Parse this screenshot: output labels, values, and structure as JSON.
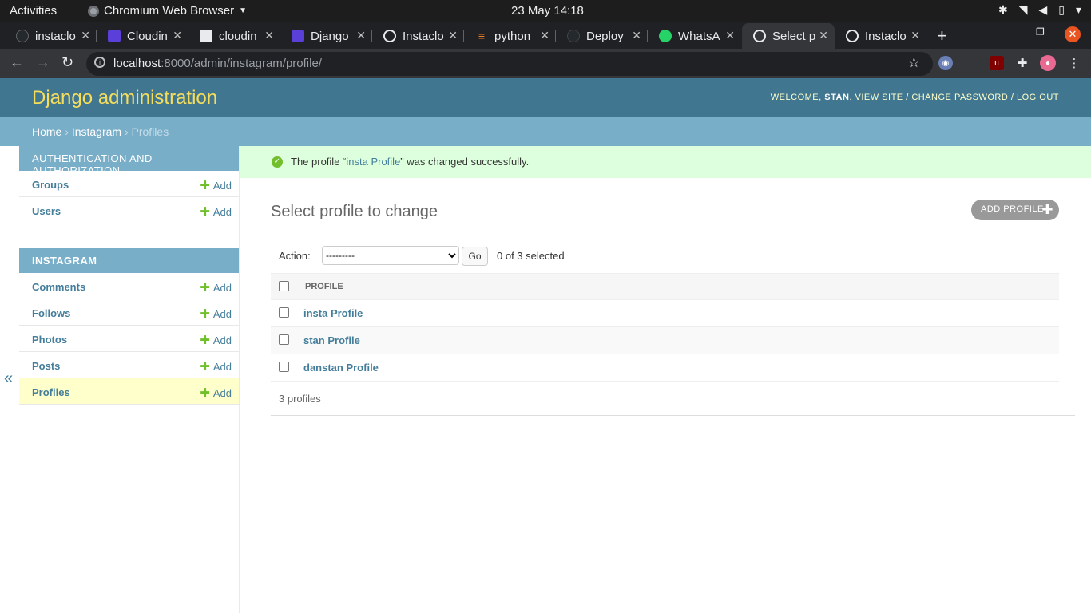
{
  "system": {
    "activities": "Activities",
    "app_name": "Chromium Web Browser",
    "clock": "23 May  14:18"
  },
  "tabs": [
    {
      "title": "instaclo",
      "icon": "github-icon",
      "color": "#24292e"
    },
    {
      "title": "Cloudin",
      "icon": "cloudinary-icon",
      "color": "#5b3fd9"
    },
    {
      "title": "cloudin",
      "icon": "package-icon",
      "color": "#e8eaed"
    },
    {
      "title": "Django",
      "icon": "cloudinary-icon",
      "color": "#5b3fd9"
    },
    {
      "title": "Instaclo",
      "icon": "globe-icon",
      "color": "#e8eaed"
    },
    {
      "title": "python",
      "icon": "stackoverflow-icon",
      "color": "#f48024"
    },
    {
      "title": "Deploy",
      "icon": "github-icon",
      "color": "#24292e"
    },
    {
      "title": "WhatsA",
      "icon": "whatsapp-icon",
      "color": "#25d366"
    },
    {
      "title": "Select p",
      "icon": "globe-icon",
      "color": "#e8eaed"
    },
    {
      "title": "Instaclo",
      "icon": "globe-icon",
      "color": "#e8eaed"
    }
  ],
  "toolbar": {
    "url_host": "localhost",
    "url_rest": ":8000/admin/instagram/profile/"
  },
  "header": {
    "branding": "Django administration",
    "welcome": "Welcome,",
    "username": "stan",
    "view_site": "View site",
    "change_password": "Change password",
    "log_out": "Log out"
  },
  "breadcrumbs": {
    "home": "Home",
    "app": "Instagram",
    "current": "Profiles"
  },
  "sidebar": {
    "toggle": "«",
    "add_label": "Add",
    "auth_caption": "AUTHENTICATION AND AUTHORIZATION",
    "auth_items": [
      {
        "name": "Groups"
      },
      {
        "name": "Users"
      }
    ],
    "insta_caption": "INSTAGRAM",
    "insta_items": [
      {
        "name": "Comments"
      },
      {
        "name": "Follows"
      },
      {
        "name": "Photos"
      },
      {
        "name": "Posts"
      },
      {
        "name": "Profiles"
      }
    ]
  },
  "message": {
    "prefix": "The profile “",
    "link": "insta Profile",
    "suffix": "” was changed successfully."
  },
  "content": {
    "title": "Select profile to change",
    "add_button": "Add profile",
    "action_label": "Action:",
    "action_selected": "---------",
    "go": "Go",
    "selected_count": "0 of 3 selected",
    "column_header": "PROFILE",
    "rows": [
      "insta Profile",
      "stan Profile",
      "danstan Profile"
    ],
    "paginator": "3 profiles"
  }
}
